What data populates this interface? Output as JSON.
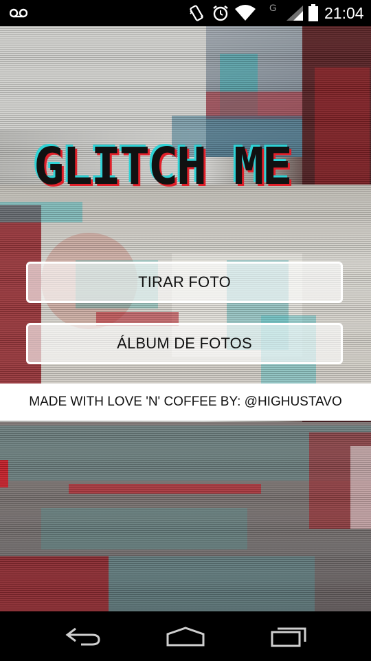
{
  "status_bar": {
    "time": "21:04",
    "network_label": "G",
    "icons": [
      "voicemail-icon",
      "phone-vibrate-icon",
      "alarm-icon",
      "wifi-icon",
      "signal-icon",
      "battery-icon"
    ]
  },
  "app": {
    "title": "GLITCH ME",
    "take_photo_label": "TIRAR FOTO",
    "album_label": "ÁLBUM DE FOTOS",
    "credits": "MADE WITH LOVE 'N' COFFEE BY: @HIGHUSTAVO"
  },
  "nav_bar": {
    "icons": [
      "back-icon",
      "home-icon",
      "recent-apps-icon"
    ]
  },
  "colors": {
    "glitch_cyan": "#2fd3d6",
    "glitch_red": "#e0202a",
    "title_dark": "#111111",
    "button_border": "#ffffff",
    "status_bar_bg": "#000000"
  }
}
